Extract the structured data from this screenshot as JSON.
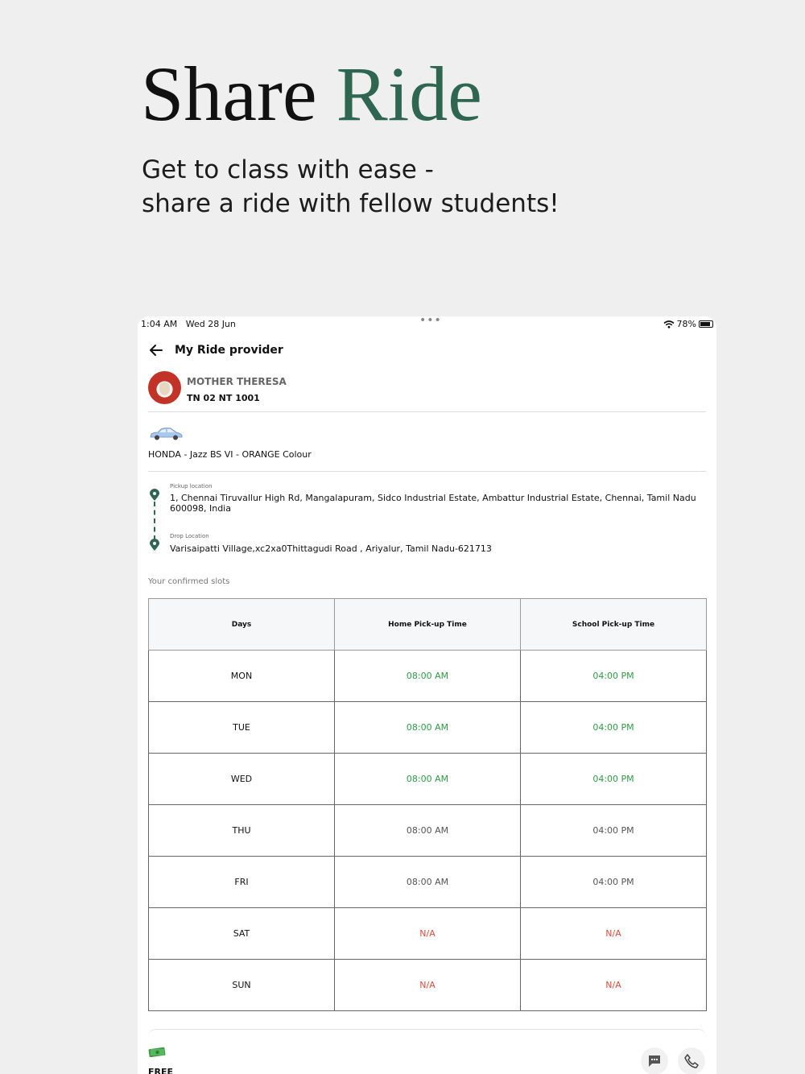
{
  "hero": {
    "title_part1": "Share",
    "title_part2": "Ride",
    "subtitle_line1": "Get to class with ease -",
    "subtitle_line2": "share a ride with fellow students!"
  },
  "status_bar": {
    "time": "1:04 AM",
    "date": "Wed 28 Jun",
    "battery": "78%"
  },
  "nav": {
    "title": "My Ride provider"
  },
  "provider": {
    "name": "MOTHER THERESA",
    "plate": "TN 02 NT 1001"
  },
  "vehicle": {
    "description": "HONDA - Jazz BS VI - ORANGE Colour"
  },
  "route": {
    "pickup_label": "Pickup location",
    "pickup_address": "1, Chennai Tiruvallur High Rd, Mangalapuram, Sidco Industrial Estate, Ambattur Industrial Estate, Chennai, Tamil Nadu 600098, India",
    "drop_label": "Drop Location",
    "drop_address": "Varisaipatti Village,xc2xa0Thittagudi Road , Ariyalur, Tamil Nadu-621713"
  },
  "slots": {
    "label": "Your confirmed slots",
    "headers": [
      "Days",
      "Home Pick-up Time",
      "School Pick-up Time"
    ],
    "rows": [
      {
        "day": "MON",
        "home": "08:00 AM",
        "school": "04:00 PM",
        "status": "confirmed"
      },
      {
        "day": "TUE",
        "home": "08:00 AM",
        "school": "04:00 PM",
        "status": "confirmed"
      },
      {
        "day": "WED",
        "home": "08:00 AM",
        "school": "04:00 PM",
        "status": "confirmed"
      },
      {
        "day": "THU",
        "home": "08:00 AM",
        "school": "04:00 PM",
        "status": "default"
      },
      {
        "day": "FRI",
        "home": "08:00 AM",
        "school": "04:00 PM",
        "status": "default"
      },
      {
        "day": "SAT",
        "home": "N/A",
        "school": "N/A",
        "status": "unavailable"
      },
      {
        "day": "SUN",
        "home": "N/A",
        "school": "N/A",
        "status": "unavailable"
      }
    ]
  },
  "footer": {
    "fare": "FREE",
    "icons": [
      "money-icon",
      "chat-icon",
      "phone-icon"
    ]
  },
  "colors": {
    "accent": "#2e6652",
    "confirmed": "#2e9d44",
    "unavailable": "#e04a3a",
    "default": "#555555"
  }
}
